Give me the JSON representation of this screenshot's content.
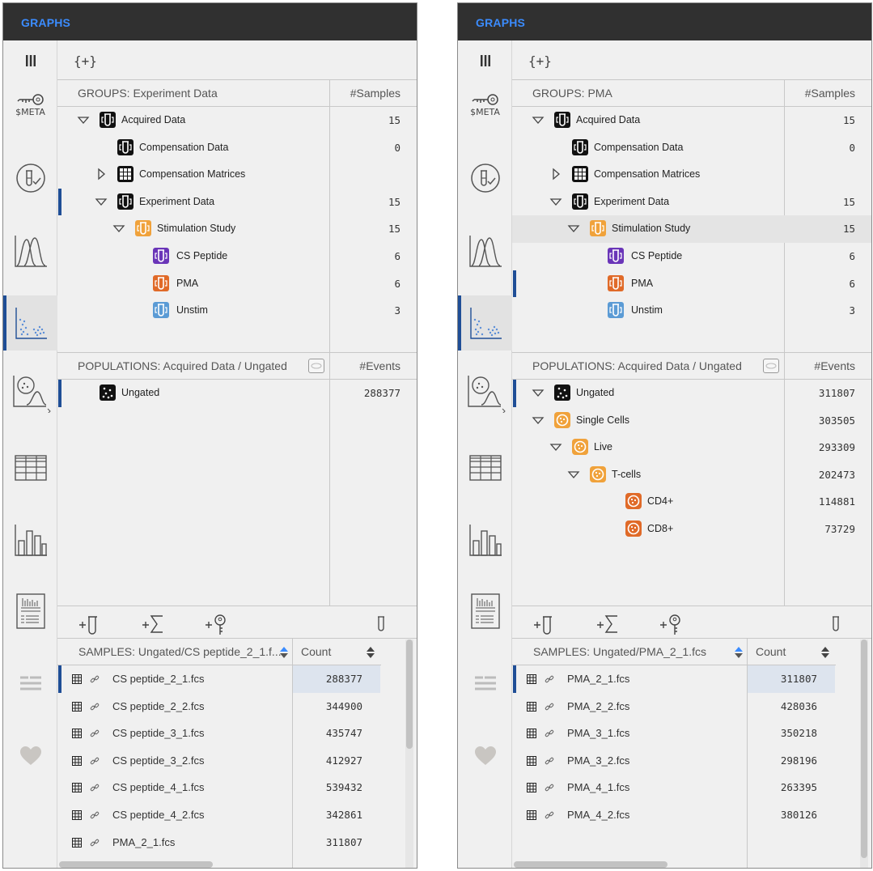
{
  "left": {
    "app_title": "GRAPHS",
    "sidebar": {
      "meta_label": "$META"
    },
    "add_group_label": "{+}",
    "groups": {
      "header": "GROUPS: Experiment Data",
      "count_header": "#Samples",
      "rows": [
        {
          "label": "Acquired Data",
          "count": "15"
        },
        {
          "label": "Compensation Data",
          "count": "0"
        },
        {
          "label": "Compensation Matrices",
          "count": ""
        },
        {
          "label": "Experiment Data",
          "count": "15"
        },
        {
          "label": "Stimulation Study",
          "count": "15"
        },
        {
          "label": "CS Peptide",
          "count": "6"
        },
        {
          "label": "PMA",
          "count": "6"
        },
        {
          "label": "Unstim",
          "count": "3"
        }
      ]
    },
    "populations": {
      "header": "POPULATIONS: Acquired Data / Ungated",
      "count_header": "#Events",
      "rows": [
        {
          "label": "Ungated",
          "count": "288377"
        }
      ]
    },
    "samples": {
      "header": "SAMPLES: Ungated/CS peptide_2_1.f...",
      "count_header": "Count",
      "rows": [
        {
          "label": "CS peptide_2_1.fcs",
          "count": "288377"
        },
        {
          "label": "CS peptide_2_2.fcs",
          "count": "344900"
        },
        {
          "label": "CS peptide_3_1.fcs",
          "count": "435747"
        },
        {
          "label": "CS peptide_3_2.fcs",
          "count": "412927"
        },
        {
          "label": "CS peptide_4_1.fcs",
          "count": "539432"
        },
        {
          "label": "CS peptide_4_2.fcs",
          "count": "342861"
        },
        {
          "label": "PMA_2_1.fcs",
          "count": "311807"
        }
      ]
    }
  },
  "right": {
    "app_title": "GRAPHS",
    "sidebar": {
      "meta_label": "$META"
    },
    "add_group_label": "{+}",
    "groups": {
      "header": "GROUPS: PMA",
      "count_header": "#Samples",
      "rows": [
        {
          "label": "Acquired Data",
          "count": "15"
        },
        {
          "label": "Compensation Data",
          "count": "0"
        },
        {
          "label": "Compensation Matrices",
          "count": ""
        },
        {
          "label": "Experiment Data",
          "count": "15"
        },
        {
          "label": "Stimulation Study",
          "count": "15"
        },
        {
          "label": "CS Peptide",
          "count": "6"
        },
        {
          "label": "PMA",
          "count": "6"
        },
        {
          "label": "Unstim",
          "count": "3"
        }
      ]
    },
    "populations": {
      "header": "POPULATIONS: Acquired Data / Ungated",
      "count_header": "#Events",
      "rows": [
        {
          "label": "Ungated",
          "count": "311807"
        },
        {
          "label": "Single Cells",
          "count": "303505"
        },
        {
          "label": "Live",
          "count": "293309"
        },
        {
          "label": "T-cells",
          "count": "202473"
        },
        {
          "label": "CD4+",
          "count": "114881"
        },
        {
          "label": "CD8+",
          "count": "73729"
        }
      ]
    },
    "samples": {
      "header": "SAMPLES: Ungated/PMA_2_1.fcs",
      "count_header": "Count",
      "rows": [
        {
          "label": "PMA_2_1.fcs",
          "count": "311807"
        },
        {
          "label": "PMA_2_2.fcs",
          "count": "428036"
        },
        {
          "label": "PMA_3_1.fcs",
          "count": "350218"
        },
        {
          "label": "PMA_3_2.fcs",
          "count": "298196"
        },
        {
          "label": "PMA_4_1.fcs",
          "count": "263395"
        },
        {
          "label": "PMA_4_2.fcs",
          "count": "380126"
        }
      ]
    }
  },
  "colors": {
    "accent": "#1f4e96",
    "title_blue": "#3b8cff",
    "tube_black": "#111111",
    "tube_orange_light": "#f0a23b",
    "tube_purple": "#6a35b8",
    "tube_orange": "#e06a28",
    "tube_blue": "#5b9bd5"
  }
}
